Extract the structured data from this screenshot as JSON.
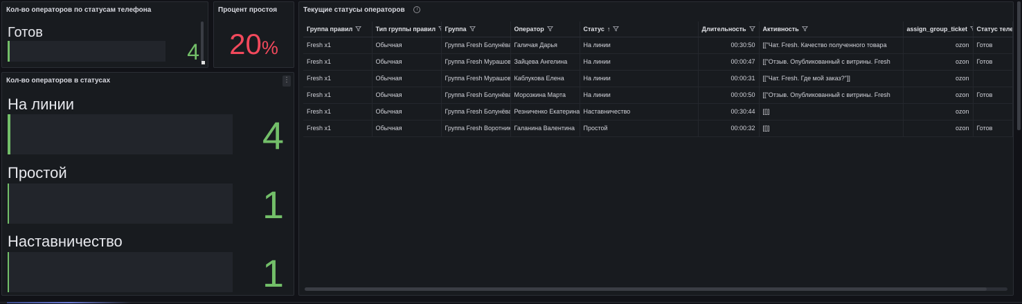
{
  "phone_panel": {
    "title": "Кол-во операторов по статусам телефона",
    "items": [
      {
        "label": "Готов",
        "value": "4",
        "fraction": 1.0
      }
    ]
  },
  "idle_panel": {
    "title": "Процент простоя",
    "value": "20",
    "unit": "%"
  },
  "status_panel": {
    "title": "Кол-во операторов в статусах",
    "menu_icon": "kebab-menu-icon",
    "items": [
      {
        "label": "На линии",
        "value": "4",
        "fraction": 1.0
      },
      {
        "label": "Простой",
        "value": "1",
        "fraction": 0.25
      },
      {
        "label": "Наставничество",
        "value": "1",
        "fraction": 0.25
      }
    ]
  },
  "table_panel": {
    "title": "Текущие статусы операторов",
    "info_icon": "info-icon",
    "columns": [
      {
        "label": "Группа правил",
        "filter": true
      },
      {
        "label": "Тип группы правил",
        "filter": true
      },
      {
        "label": "Группа",
        "filter": true
      },
      {
        "label": "Оператор",
        "filter": true
      },
      {
        "label": "Статус",
        "sort": "↑",
        "filter": true
      },
      {
        "label": "Длительность",
        "filter": true
      },
      {
        "label": "Активность",
        "filter": true
      },
      {
        "label": "assign_group_ticket",
        "filter": true
      },
      {
        "label": "Статус телефона",
        "filter": false
      }
    ],
    "rows": [
      [
        "Fresh x1",
        "Обычная",
        "Группа Fresh Болунёва",
        "Галичая Дарья",
        "На линии",
        "00:30:50",
        "[[\"Чат. Fresh. Качество полученного товара",
        "ozon",
        "Готов"
      ],
      [
        "Fresh x1",
        "Обычная",
        "Группа Fresh Мурашова",
        "Зайцева Ангелина",
        "На линии",
        "00:00:47",
        "[[\"Отзыв. Опубликованный с витрины. Fresh",
        "ozon",
        "Готов"
      ],
      [
        "Fresh x1",
        "Обычная",
        "Группа Fresh Мурашова",
        "Каблукова Елена",
        "На линии",
        "00:00:31",
        "[[\"Чат. Fresh. Где мой заказ?\"]]",
        "ozon",
        ""
      ],
      [
        "Fresh x1",
        "Обычная",
        "Группа Fresh Болунёва",
        "Морозкина Марта",
        "На линии",
        "00:00:50",
        "[[\"Отзыв. Опубликованный с витрины. Fresh",
        "ozon",
        "Готов"
      ],
      [
        "Fresh x1",
        "Обычная",
        "Группа Fresh Болунёва",
        "Резниченко Екатерина",
        "Наставничество",
        "00:30:44",
        "[[]]",
        "ozon",
        ""
      ],
      [
        "Fresh x1",
        "Обычная",
        "Группа Fresh Воротникова",
        "Галанина Валентина",
        "Простой",
        "00:00:32",
        "[[]]",
        "ozon",
        "Готов"
      ]
    ]
  },
  "colors": {
    "accent_green": "#73bf69",
    "accent_red": "#f2495c",
    "background": "#111217",
    "panel": "#181b1f"
  }
}
